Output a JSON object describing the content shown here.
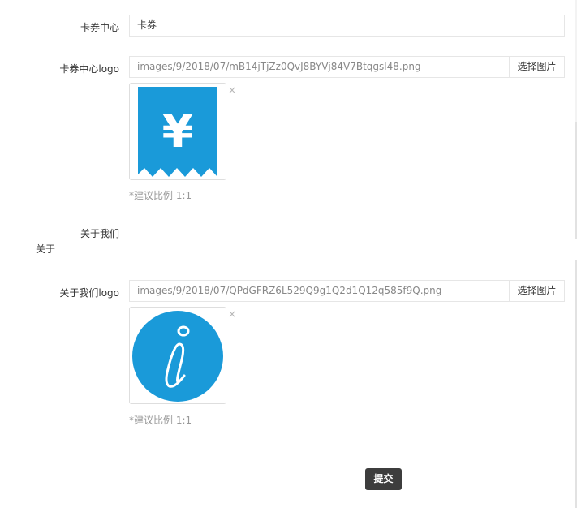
{
  "fields": {
    "coupon_center": {
      "label": "卡券中心",
      "value": "卡券"
    },
    "coupon_logo": {
      "label": "卡券中心logo",
      "path": "images/9/2018/07/mB14jTjZz0QvJ8BYVj84V7Btqgsl48.png",
      "pick_label": "选择图片",
      "remove_label": "×",
      "hint": "*建议比例 1:1",
      "icon_glyph": "¥",
      "icon": "yen-ticket-icon",
      "icon_color": "#1a9ad9"
    },
    "about_us": {
      "label": "关于我们",
      "value": "关于"
    },
    "about_logo": {
      "label": "关于我们logo",
      "path": "images/9/2018/07/QPdGFRZ6L529Q9g1Q2d1Q12q585f9Q.png",
      "pick_label": "选择图片",
      "remove_label": "×",
      "hint": "*建议比例 1:1",
      "icon": "info-circle-icon",
      "icon_color": "#1a9ad9"
    }
  },
  "submit_label": "提交"
}
